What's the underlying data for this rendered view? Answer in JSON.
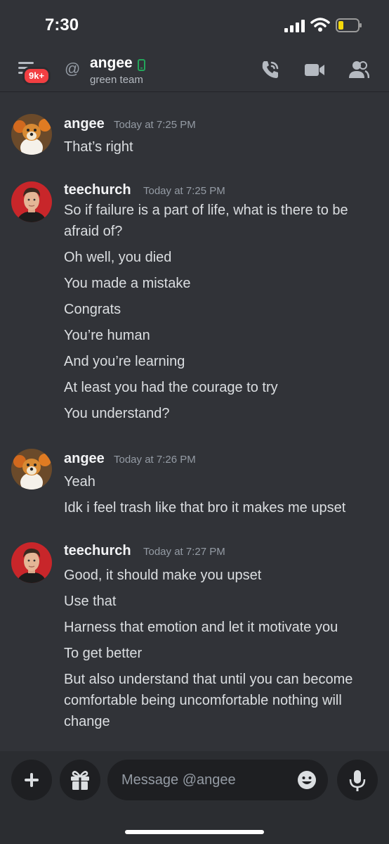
{
  "status_bar": {
    "time": "7:30"
  },
  "header": {
    "badge": "9k+",
    "at_symbol": "@",
    "name": "angee",
    "subtitle": "green team"
  },
  "messages": [
    {
      "user": "angee",
      "timestamp": "Today at 7:25 PM",
      "avatar": "dog-avatar",
      "lines": [
        "That’s right"
      ]
    },
    {
      "user": "teechurch",
      "timestamp": "Today at 7:25 PM",
      "avatar": "man-avatar",
      "lines": [
        "So if failure is a part of life, what is there to be afraid of?",
        "Oh well, you died",
        "You made a mistake",
        "Congrats",
        "You’re human",
        "And you’re learning",
        "At least you had the courage to try",
        "You understand?"
      ]
    },
    {
      "user": "angee",
      "timestamp": "Today at 7:26 PM",
      "avatar": "dog-avatar",
      "lines": [
        "Yeah",
        "Idk i feel trash like that bro it makes me upset"
      ]
    },
    {
      "user": "teechurch",
      "timestamp": "Today at 7:27 PM",
      "avatar": "man-avatar",
      "lines": [
        "Good, it should make you upset",
        "Use that",
        "Harness that emotion and let it motivate you",
        "To get better",
        "But also understand that until you can become comfortable being uncomfortable nothing will change"
      ]
    }
  ],
  "composer": {
    "placeholder": "Message @angee"
  },
  "colors": {
    "background": "#313338",
    "badge": "#f23f42",
    "online_phone": "#23a55a"
  }
}
